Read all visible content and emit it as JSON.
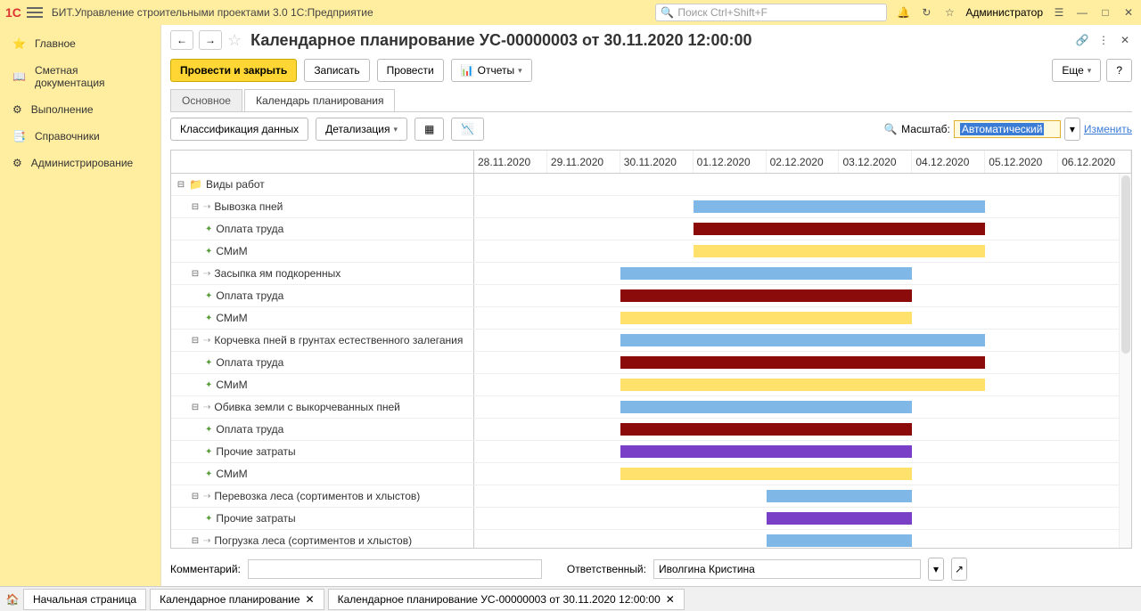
{
  "app": {
    "title": "БИТ.Управление строительными проектами 3.0 1С:Предприятие",
    "logo": "1С",
    "search_placeholder": "Поиск Ctrl+Shift+F",
    "user": "Администратор"
  },
  "sidebar": {
    "items": [
      {
        "label": "Главное",
        "icon": "home"
      },
      {
        "label": "Сметная документация",
        "icon": "book"
      },
      {
        "label": "Выполнение",
        "icon": "exec"
      },
      {
        "label": "Справочники",
        "icon": "ref"
      },
      {
        "label": "Администрирование",
        "icon": "gear"
      }
    ]
  },
  "page": {
    "title": "Календарное планирование УС-00000003 от 30.11.2020 12:00:00",
    "btn_post_close": "Провести и закрыть",
    "btn_save": "Записать",
    "btn_post": "Провести",
    "btn_reports": "Отчеты",
    "btn_more": "Еще",
    "btn_help": "?"
  },
  "tabs": {
    "main": "Основное",
    "cal": "Календарь планирования"
  },
  "toolbar": {
    "classify": "Классификация данных",
    "detail": "Детализация",
    "scale_label": "Масштаб:",
    "scale_value": "Автоматический",
    "change": "Изменить"
  },
  "dates": [
    "28.11.2020",
    "29.11.2020",
    "30.11.2020",
    "01.12.2020",
    "02.12.2020",
    "03.12.2020",
    "04.12.2020",
    "05.12.2020",
    "06.12.2020"
  ],
  "rows": [
    {
      "name": "Виды работ",
      "lvl": 0,
      "exp": "-",
      "icon": "folder"
    },
    {
      "name": "Вывозка пней",
      "lvl": 1,
      "exp": "-",
      "icon": "task",
      "bar": {
        "start": 3,
        "span": 4,
        "cls": "c-blue"
      }
    },
    {
      "name": "Оплата труда",
      "lvl": 2,
      "icon": "leaf",
      "bar": {
        "start": 3,
        "span": 4,
        "cls": "c-red"
      }
    },
    {
      "name": "СМиМ",
      "lvl": 2,
      "icon": "leaf",
      "bar": {
        "start": 3,
        "span": 4,
        "cls": "c-yellow"
      }
    },
    {
      "name": "Засыпка ям подкоренных",
      "lvl": 1,
      "exp": "-",
      "icon": "task",
      "bar": {
        "start": 2,
        "span": 4,
        "cls": "c-blue"
      }
    },
    {
      "name": "Оплата труда",
      "lvl": 2,
      "icon": "leaf",
      "bar": {
        "start": 2,
        "span": 4,
        "cls": "c-red"
      }
    },
    {
      "name": "СМиМ",
      "lvl": 2,
      "icon": "leaf",
      "bar": {
        "start": 2,
        "span": 4,
        "cls": "c-yellow"
      }
    },
    {
      "name": "Корчевка пней в грунтах естественного залегания",
      "lvl": 1,
      "exp": "-",
      "icon": "task",
      "bar": {
        "start": 2,
        "span": 5,
        "cls": "c-blue"
      }
    },
    {
      "name": "Оплата труда",
      "lvl": 2,
      "icon": "leaf",
      "bar": {
        "start": 2,
        "span": 5,
        "cls": "c-red"
      }
    },
    {
      "name": "СМиМ",
      "lvl": 2,
      "icon": "leaf",
      "bar": {
        "start": 2,
        "span": 5,
        "cls": "c-yellow"
      }
    },
    {
      "name": "Обивка земли с выкорчеванных пней",
      "lvl": 1,
      "exp": "-",
      "icon": "task",
      "bar": {
        "start": 2,
        "span": 4,
        "cls": "c-blue"
      }
    },
    {
      "name": "Оплата труда",
      "lvl": 2,
      "icon": "leaf",
      "bar": {
        "start": 2,
        "span": 4,
        "cls": "c-red"
      }
    },
    {
      "name": "Прочие затраты",
      "lvl": 2,
      "icon": "leaf",
      "bar": {
        "start": 2,
        "span": 4,
        "cls": "c-purple"
      }
    },
    {
      "name": "СМиМ",
      "lvl": 2,
      "icon": "leaf",
      "bar": {
        "start": 2,
        "span": 4,
        "cls": "c-yellow"
      }
    },
    {
      "name": "Перевозка леса (сортиментов и хлыстов)",
      "lvl": 1,
      "exp": "-",
      "icon": "task",
      "bar": {
        "start": 4,
        "span": 2,
        "cls": "c-blue"
      }
    },
    {
      "name": "Прочие затраты",
      "lvl": 2,
      "icon": "leaf",
      "bar": {
        "start": 4,
        "span": 2,
        "cls": "c-purple"
      }
    },
    {
      "name": "Погрузка леса (сортиментов и хлыстов)",
      "lvl": 1,
      "exp": "-",
      "icon": "task",
      "bar": {
        "start": 4,
        "span": 2,
        "cls": "c-blue"
      }
    }
  ],
  "footer": {
    "comment_label": "Комментарий:",
    "responsible_label": "Ответственный:",
    "responsible_value": "Иволгина Кристина"
  },
  "bottom_tabs": {
    "home": "Начальная страница",
    "t1": "Календарное планирование",
    "t2": "Календарное планирование УС-00000003 от 30.11.2020 12:00:00"
  }
}
